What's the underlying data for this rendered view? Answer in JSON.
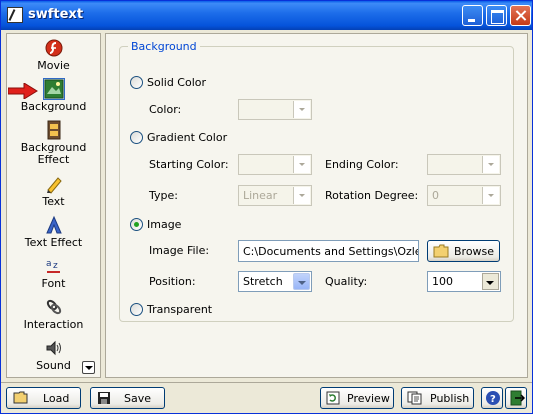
{
  "window": {
    "title": "swftext"
  },
  "sidebar": {
    "items": [
      {
        "label": "Movie",
        "icon": "flash-icon"
      },
      {
        "label": "Background",
        "icon": "background-icon"
      },
      {
        "label": "Background Effect",
        "icon": "film-icon"
      },
      {
        "label": "Text",
        "icon": "pencil-icon"
      },
      {
        "label": "Text Effect",
        "icon": "text-effect-icon"
      },
      {
        "label": "Font",
        "icon": "font-icon"
      },
      {
        "label": "Interaction",
        "icon": "link-icon"
      },
      {
        "label": "Sound",
        "icon": "speaker-icon"
      }
    ],
    "selected": "Background"
  },
  "panel": {
    "legend": "Background",
    "solid": {
      "label": "Solid Color",
      "color_label": "Color:",
      "color_value": ""
    },
    "gradient": {
      "label": "Gradient Color",
      "starting_label": "Starting Color:",
      "ending_label": "Ending Color:",
      "type_label": "Type:",
      "type_value": "Linear",
      "rotation_label": "Rotation Degree:",
      "rotation_value": "0"
    },
    "image": {
      "label": "Image",
      "file_label": "Image File:",
      "file_value": "C:\\Documents and Settings\\Ozlem\\",
      "browse_label": "Browse",
      "position_label": "Position:",
      "position_value": "Stretch",
      "quality_label": "Quality:",
      "quality_value": "100"
    },
    "transparent": {
      "label": "Transparent"
    },
    "selected_option": "Image"
  },
  "footer": {
    "load_label": "Load",
    "save_label": "Save",
    "preview_label": "Preview",
    "publish_label": "Publish"
  },
  "colors": {
    "titlebar": "#0A5FE9",
    "legend": "#0046D5",
    "window_bg": "#ECE9D8",
    "panel_bg": "#F6F5EE"
  }
}
